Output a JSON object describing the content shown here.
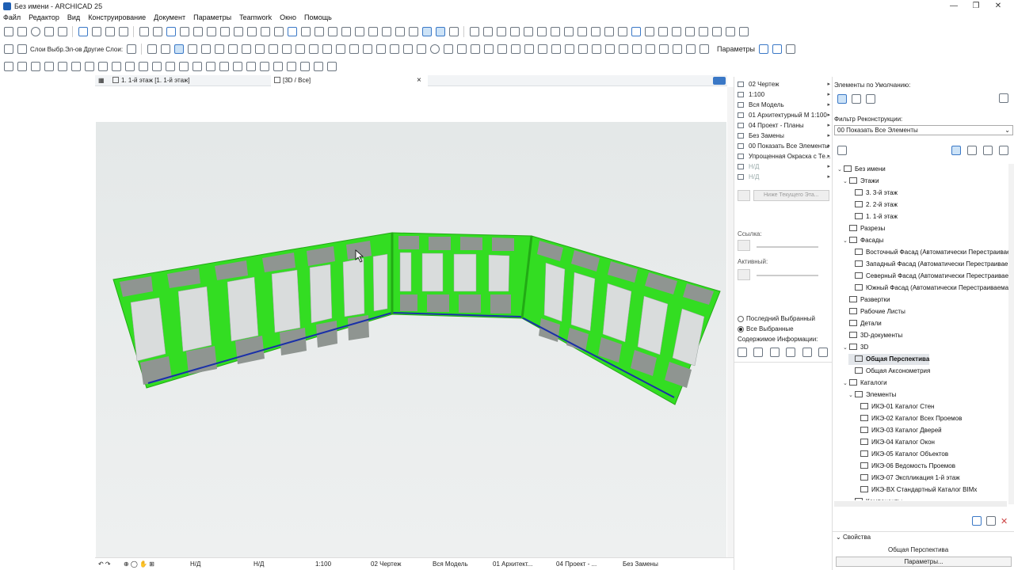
{
  "window": {
    "title": "Без имени - ARCHICAD 25",
    "minimize": "—",
    "maximize": "❐",
    "close": "✕"
  },
  "menu": [
    "Файл",
    "Редактор",
    "Вид",
    "Конструирование",
    "Документ",
    "Параметры",
    "Teamwork",
    "Окно",
    "Помощь"
  ],
  "toolbar": {
    "layers_label": "Слои Выбр.Эл-ов",
    "other_layers_label": "Другие Слои:",
    "parameters_label": "Параметры"
  },
  "tabs": {
    "floor_plan": "1. 1-й этаж [1. 1-й этаж]",
    "view3d": "[3D / Все]",
    "close": "×"
  },
  "quick_options": {
    "rows": [
      "02 Чертеж",
      "1:100",
      "Вся Модель",
      "01 Архитектурный М 1:100",
      "04 Проект - Планы",
      "Без Замены",
      "00 Показать Все Элементы",
      "Упрощенная Окраска с Те...",
      "Н/Д",
      "Н/Д"
    ],
    "below_current": "Ниже Текущего Эта...",
    "link_label": "Ссылка:",
    "active_label": "Активный:",
    "last_selected": "Последний Выбранный",
    "all_selected": "Все Выбранные",
    "info_contents": "Содержимое Информации:"
  },
  "navigator": {
    "default_elements_label": "Элементы по Умолчанию:",
    "reconstruction_filter_label": "Фильтр Реконструкции:",
    "reconstruction_filter_value": "00 Показать Все Элементы",
    "tree": [
      {
        "label": "Без имени",
        "level": 0,
        "twisty": "⌄",
        "selected": false
      },
      {
        "label": "Этажи",
        "level": 1,
        "twisty": "⌄",
        "selected": false
      },
      {
        "label": "3. 3-й этаж",
        "level": 2,
        "twisty": "",
        "selected": false
      },
      {
        "label": "2. 2-й этаж",
        "level": 2,
        "twisty": "",
        "selected": false
      },
      {
        "label": "1. 1-й этаж",
        "level": 2,
        "twisty": "",
        "selected": false
      },
      {
        "label": "Разрезы",
        "level": 1,
        "twisty": "",
        "selected": false
      },
      {
        "label": "Фасады",
        "level": 1,
        "twisty": "⌄",
        "selected": false
      },
      {
        "label": "Восточный Фасад (Автоматически Перестраиваем",
        "level": 2,
        "twisty": "",
        "selected": false
      },
      {
        "label": "Западный Фасад (Автоматически Перестраиваем",
        "level": 2,
        "twisty": "",
        "selected": false
      },
      {
        "label": "Северный Фасад (Автоматически Перестраиваем",
        "level": 2,
        "twisty": "",
        "selected": false
      },
      {
        "label": "Южный Фасад (Автоматически Перестраиваема",
        "level": 2,
        "twisty": "",
        "selected": false
      },
      {
        "label": "Развертки",
        "level": 1,
        "twisty": "",
        "selected": false
      },
      {
        "label": "Рабочие Листы",
        "level": 1,
        "twisty": "",
        "selected": false
      },
      {
        "label": "Детали",
        "level": 1,
        "twisty": "",
        "selected": false
      },
      {
        "label": "3D-документы",
        "level": 1,
        "twisty": "",
        "selected": false
      },
      {
        "label": "3D",
        "level": 1,
        "twisty": "⌄",
        "selected": false
      },
      {
        "label": "Общая Перспектива",
        "level": 2,
        "twisty": "",
        "selected": true
      },
      {
        "label": "Общая Аксонометрия",
        "level": 2,
        "twisty": "",
        "selected": false
      },
      {
        "label": "Каталоги",
        "level": 1,
        "twisty": "⌄",
        "selected": false
      },
      {
        "label": "Элементы",
        "level": 2,
        "twisty": "⌄",
        "selected": false
      },
      {
        "label": "ИКЭ-01 Каталог Стен",
        "level": 3,
        "twisty": "",
        "selected": false
      },
      {
        "label": "ИКЭ-02 Каталог Всех Проемов",
        "level": 3,
        "twisty": "",
        "selected": false
      },
      {
        "label": "ИКЭ-03 Каталог Дверей",
        "level": 3,
        "twisty": "",
        "selected": false
      },
      {
        "label": "ИКЭ-04 Каталог Окон",
        "level": 3,
        "twisty": "",
        "selected": false
      },
      {
        "label": "ИКЭ-05 Каталог Объектов",
        "level": 3,
        "twisty": "",
        "selected": false
      },
      {
        "label": "ИКЭ-06 Ведомость Проемов",
        "level": 3,
        "twisty": "",
        "selected": false
      },
      {
        "label": "ИКЭ-07 Экспликация 1-й этаж",
        "level": 3,
        "twisty": "",
        "selected": false
      },
      {
        "label": "ИКЭ-BX Стандартный Каталог BIMx",
        "level": 3,
        "twisty": "",
        "selected": false
      },
      {
        "label": "Компоненты",
        "level": 2,
        "twisty": "›",
        "selected": false
      }
    ],
    "properties_label": "Свойства",
    "properties_value": "Общая Перспектива",
    "parameters_button": "Параметры..."
  },
  "status_bar": {
    "nd1": "Н/Д",
    "nd2": "Н/Д",
    "scale": "1:100",
    "layer_combo": "02 Чертеж",
    "model": "Вся Модель",
    "pen_set": "01 Архитект...",
    "plan_set": "04 Проект - ...",
    "override": "Без Замены"
  },
  "colors": {
    "selection_green": "#33dd22",
    "wall_line_blue": "#1a30a8",
    "accent": "#3a78c6"
  }
}
